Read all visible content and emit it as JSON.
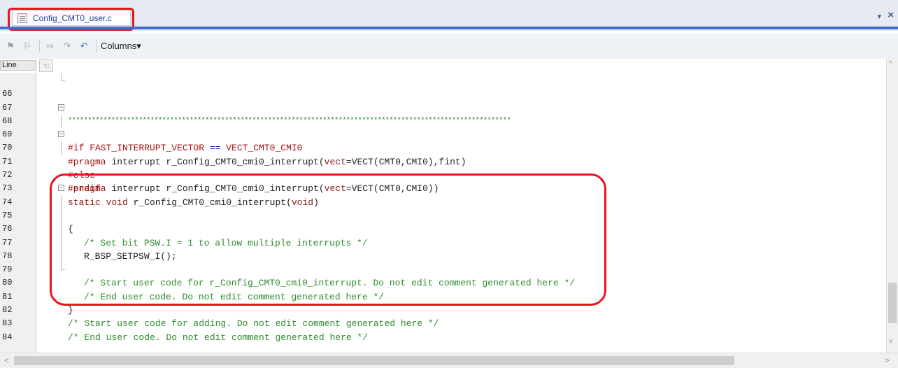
{
  "tab": {
    "title": "Config_CMT0_user.c",
    "menu_glyph": "▾",
    "close_glyph": "×"
  },
  "toolbar": {
    "columns_label": "Columns▾"
  },
  "editor": {
    "line_header": "Line",
    "lines": [
      {
        "n": "66",
        "code": "*****************************************************************************************************************"
      },
      {
        "n": "67",
        "code": ""
      },
      {
        "n": "68",
        "pre": "#if FAST_INTERRUPT_VECTOR ",
        "op": "==",
        "post": " VECT_CMT0_CMI0"
      },
      {
        "n": "69",
        "dir": "#pragma",
        "mid": " interrupt r_Config_CMT0_cmi0_interrupt(",
        "kw": "vect",
        "rest": "=VECT(CMT0,CMI0),fint)"
      },
      {
        "n": "70",
        "code": "#else"
      },
      {
        "n": "71",
        "dir": "#pragma",
        "mid": " interrupt r_Config_CMT0_cmi0_interrupt(",
        "kw": "vect",
        "rest": "=VECT(CMT0,CMI0))"
      },
      {
        "n": "72",
        "code": "#endif"
      },
      {
        "n": "73",
        "kw1": "static void",
        "mid": " r_Config_CMT0_cmi0_interrupt(",
        "kw2": "void",
        "end": ")"
      },
      {
        "n": "74",
        "code": "{"
      },
      {
        "n": "75",
        "code": "/* Set bit PSW.I = 1 to allow multiple interrupts */"
      },
      {
        "n": "76",
        "code": "R_BSP_SETPSW_I();"
      },
      {
        "n": "77",
        "code": ""
      },
      {
        "n": "78",
        "code": "/* Start user code for r_Config_CMT0_cmi0_interrupt. Do not edit comment generated here */"
      },
      {
        "n": "79",
        "code": "/* End user code. Do not edit comment generated here */"
      },
      {
        "n": "80",
        "code": "}"
      },
      {
        "n": "81",
        "code": ""
      },
      {
        "n": "82",
        "code": "/* Start user code for adding. Do not edit comment generated here */"
      },
      {
        "n": "83",
        "code": "/* End user code. Do not edit comment generated here */"
      },
      {
        "n": "84",
        "code": ""
      }
    ]
  }
}
